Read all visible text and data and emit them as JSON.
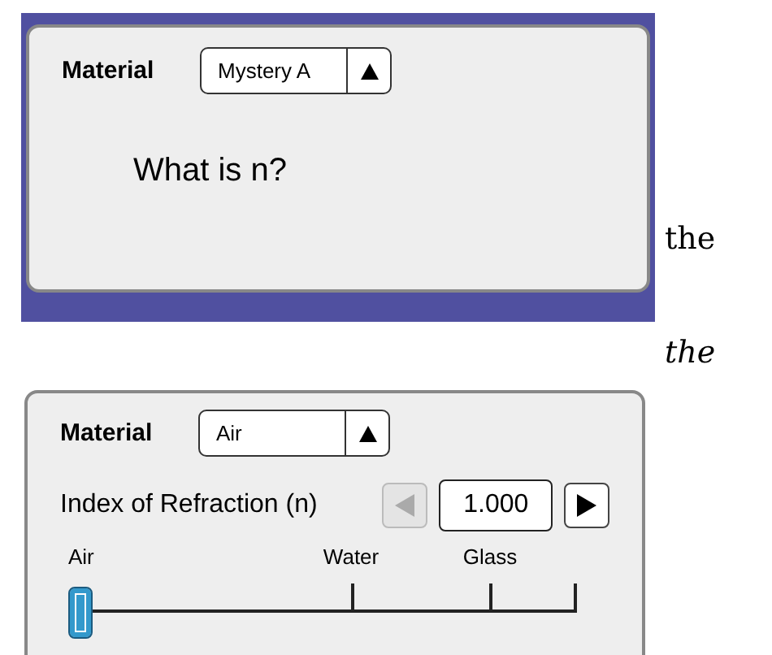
{
  "top_panel": {
    "material_label": "Material",
    "material": {
      "value": "Mystery A"
    },
    "question": "What is n?"
  },
  "side_texts": [
    {
      "text": "the",
      "italic": false
    },
    {
      "text": "the",
      "italic": true
    }
  ],
  "bottom_panel": {
    "material_label": "Material",
    "material": {
      "value": "Air"
    },
    "index": {
      "label": "Index of Refraction (n)",
      "value": "1.000",
      "decrement_disabled": true,
      "increment_disabled": false
    },
    "slider": {
      "level": 0,
      "ticks": [
        {
          "label": "Air"
        },
        {
          "label": "Water"
        },
        {
          "label": "Glass"
        }
      ]
    }
  }
}
